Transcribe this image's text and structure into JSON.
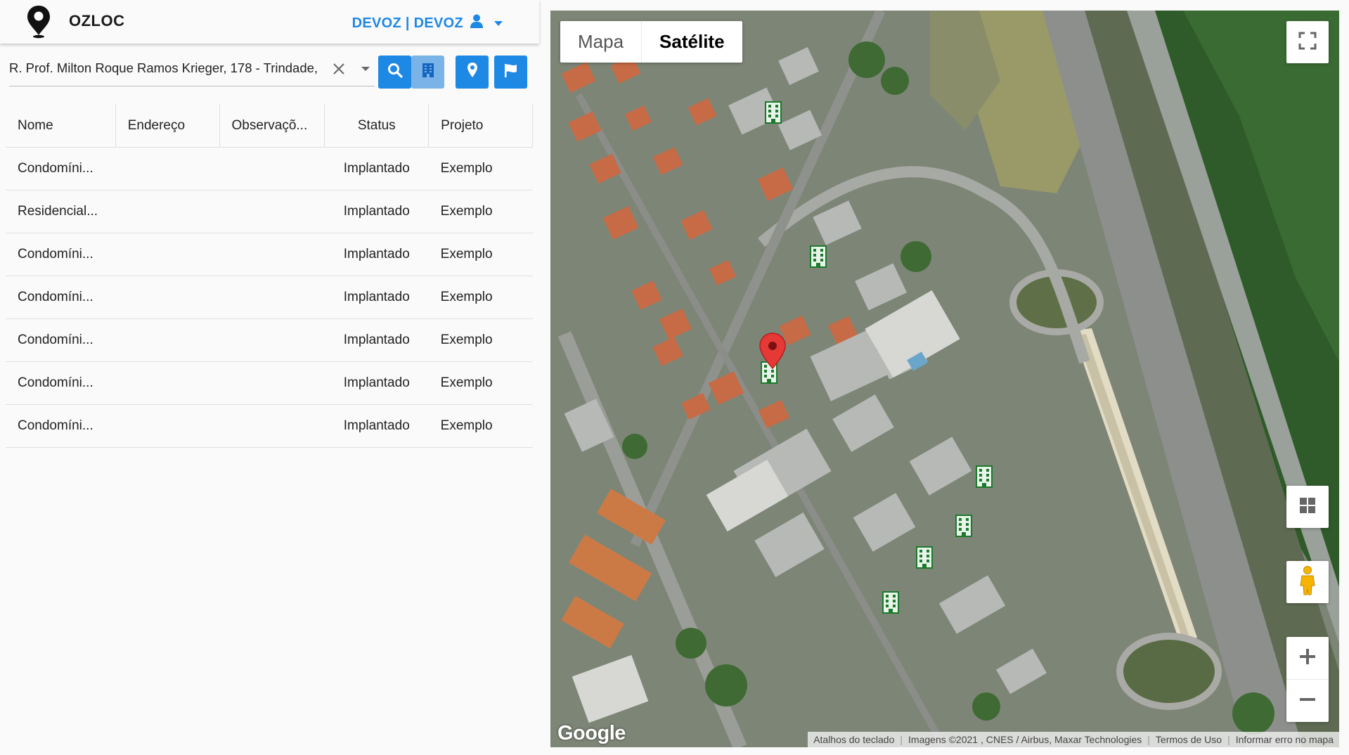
{
  "app": {
    "brand": "OZLOC",
    "user": "DEVOZ | DEVOZ"
  },
  "icons": {
    "logo": "map-pin-logo",
    "user": "user-icon",
    "clear": "close-icon",
    "search": "search-icon",
    "building": "building-icon",
    "pin": "location-pin-icon",
    "flag": "flag-icon"
  },
  "colors": {
    "accent": "#1e88e5",
    "marker_green": "#1b7a2c",
    "pin_red": "#e53935"
  },
  "search": {
    "value": "R. Prof. Milton Roque Ramos Krieger, 178 - Trindade,"
  },
  "table": {
    "headers": [
      "Nome",
      "Endereço",
      "Observaçõ...",
      "Status",
      "Projeto"
    ],
    "rows": [
      [
        "Condomíni...",
        "",
        "",
        "Implantado",
        "Exemplo"
      ],
      [
        "Residencial...",
        "",
        "",
        "Implantado",
        "Exemplo"
      ],
      [
        "Condomíni...",
        "",
        "",
        "Implantado",
        "Exemplo"
      ],
      [
        "Condomíni...",
        "",
        "",
        "Implantado",
        "Exemplo"
      ],
      [
        "Condomíni...",
        "",
        "",
        "Implantado",
        "Exemplo"
      ],
      [
        "Condomíni...",
        "",
        "",
        "Implantado",
        "Exemplo"
      ],
      [
        "Condomíni...",
        "",
        "",
        "Implantado",
        "Exemplo"
      ]
    ]
  },
  "map": {
    "type_buttons": [
      "Mapa",
      "Satélite"
    ],
    "selected_type": "Satélite",
    "logo": "Google",
    "attribution": {
      "shortcuts": "Atalhos do teclado",
      "imagery": "Imagens ©2021 , CNES / Airbus, Maxar Technologies",
      "terms": "Termos de Uso",
      "report": "Informar erro no mapa"
    },
    "controls": [
      "fullscreen-icon",
      "layers-icon",
      "pegman-icon",
      "zoom-in-icon",
      "zoom-out-icon"
    ]
  }
}
